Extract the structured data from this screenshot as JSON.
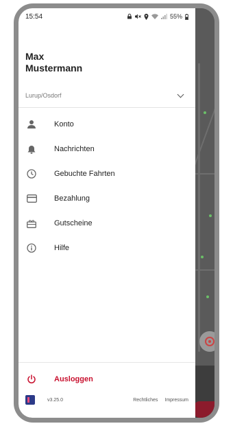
{
  "status_bar": {
    "time": "15:54",
    "battery": "55%"
  },
  "user": {
    "name": "Max\nMustermann"
  },
  "location": {
    "value": "Lurup/Osdorf"
  },
  "menu": {
    "items": [
      {
        "label": "Konto",
        "icon": "person-icon"
      },
      {
        "label": "Nachrichten",
        "icon": "bell-icon"
      },
      {
        "label": "Gebuchte Fahrten",
        "icon": "clock-icon"
      },
      {
        "label": "Bezahlung",
        "icon": "credit-card-icon"
      },
      {
        "label": "Gutscheine",
        "icon": "voucher-icon"
      },
      {
        "label": "Hilfe",
        "icon": "info-icon"
      }
    ]
  },
  "logout": {
    "label": "Ausloggen"
  },
  "footer": {
    "version": "v3.25.0",
    "legal_label": "Rechtliches",
    "imprint_label": "Impressum"
  },
  "colors": {
    "accent": "#c8102e",
    "logo_blue": "#2c3a88"
  }
}
